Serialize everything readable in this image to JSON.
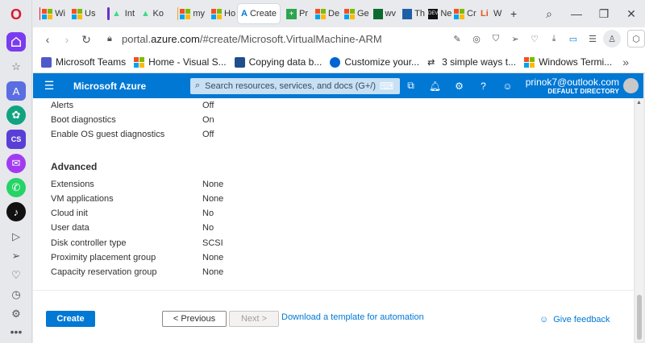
{
  "browser": {
    "tabs": [
      {
        "label": "Wi",
        "color": "#e0162b"
      },
      {
        "label": "Us",
        "color": ""
      },
      {
        "label": "Int",
        "color": "#6b2fc7"
      },
      {
        "label": "Ko",
        "color": ""
      },
      {
        "label": "my",
        "color": "#f0a020"
      },
      {
        "label": "Ho",
        "color": ""
      },
      {
        "label": "Create",
        "color": ""
      },
      {
        "label": "Pr",
        "color": ""
      },
      {
        "label": "De",
        "color": ""
      },
      {
        "label": "Ge",
        "color": ""
      },
      {
        "label": "wv",
        "color": ""
      },
      {
        "label": "Th",
        "color": ""
      },
      {
        "label": "Ne",
        "color": ""
      },
      {
        "label": "Cr",
        "color": ""
      },
      {
        "label": "W",
        "color": ""
      }
    ],
    "url_prefix": "portal.",
    "url_domain": "azure.com",
    "url_path": "/#create/Microsoft.VirtualMachine-ARM",
    "bookmarks": [
      "Microsoft Teams",
      "Home - Visual S...",
      "Copying data b...",
      "Customize your...",
      "3 simple ways t...",
      "Windows Termi..."
    ]
  },
  "azure": {
    "title": "Microsoft Azure",
    "search_placeholder": "Search resources, services, and docs (G+/)",
    "user_email": "prinok7@outlook.com",
    "user_directory": "DEFAULT DIRECTORY",
    "brand_color": "#0078d4"
  },
  "monitoring": [
    {
      "label": "Alerts",
      "value": "Off"
    },
    {
      "label": "Boot diagnostics",
      "value": "On"
    },
    {
      "label": "Enable OS guest diagnostics",
      "value": "Off"
    }
  ],
  "advanced": {
    "title": "Advanced",
    "rows": [
      {
        "label": "Extensions",
        "value": "None"
      },
      {
        "label": "VM applications",
        "value": "None"
      },
      {
        "label": "Cloud init",
        "value": "No"
      },
      {
        "label": "User data",
        "value": "No"
      },
      {
        "label": "Disk controller type",
        "value": "SCSI"
      },
      {
        "label": "Proximity placement group",
        "value": "None"
      },
      {
        "label": "Capacity reservation group",
        "value": "None"
      }
    ]
  },
  "footer": {
    "create": "Create",
    "previous": "< Previous",
    "next": "Next >",
    "template_link": "Download a template for automation",
    "feedback": "Give feedback"
  }
}
